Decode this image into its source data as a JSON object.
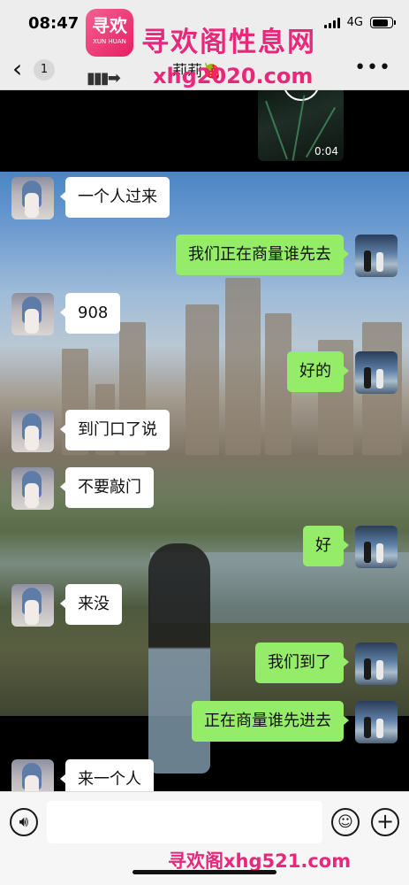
{
  "status_bar": {
    "time": "08:47",
    "network": "4G"
  },
  "nav": {
    "back_icon": "chevron-left-icon",
    "unread_count": "1",
    "title": "莉莉🍓",
    "more_icon": "more-dots-icon"
  },
  "watermark": {
    "logo_big": "寻欢",
    "logo_small": "XUN HUAN",
    "name": "寻欢阁性息网",
    "arrow": "▮▮▮➡",
    "url": "xhg2020.com",
    "footer": "寻欢阁xhg521.com"
  },
  "video": {
    "duration": "0:04"
  },
  "messages": [
    {
      "from": "her",
      "text": "一个人过来"
    },
    {
      "from": "me",
      "text": "我们正在商量谁先去"
    },
    {
      "from": "her",
      "text": "908"
    },
    {
      "from": "me",
      "text": "好的"
    },
    {
      "from": "her",
      "text": "到门口了说"
    },
    {
      "from": "her",
      "text": "不要敲门"
    },
    {
      "from": "me",
      "text": "好"
    },
    {
      "from": "her",
      "text": "来没"
    },
    {
      "from": "me",
      "text": "我们到了"
    },
    {
      "from": "me",
      "text": "正在商量谁先进去"
    },
    {
      "from": "her",
      "text": "来一个人"
    }
  ],
  "input_bar": {
    "voice_icon": "voice-icon",
    "emoji_icon": "emoji-icon",
    "plus_icon": "plus-icon",
    "input_value": ""
  },
  "colors": {
    "bubble_out": "#95ec69",
    "bubble_in": "#ffffff",
    "watermark": "#e8287a",
    "nav_bg": "#ededed"
  }
}
